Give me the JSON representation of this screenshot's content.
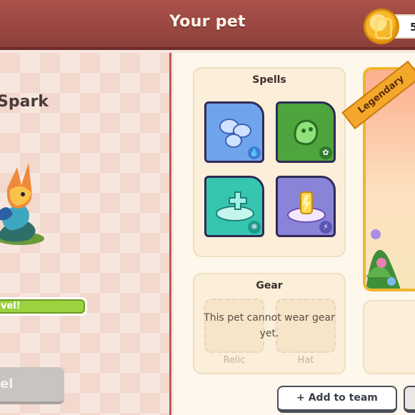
{
  "header": {
    "title": "Your pet"
  },
  "coins": {
    "count": "5",
    "icon": "gold-coin-icon"
  },
  "pet": {
    "name": "Spark",
    "level_text": "vel!",
    "level_button_label": "el"
  },
  "spells": {
    "title": "Spells",
    "items": [
      {
        "name": "water-spell-icon",
        "color": "#6fa3ec",
        "badge_color": "#3f7cd6"
      },
      {
        "name": "earth-spell-icon",
        "color": "#4ea43d",
        "badge_color": "#2f7a2a"
      },
      {
        "name": "ice-spell-icon",
        "color": "#36c6b0",
        "badge_color": "#1e9a8c"
      },
      {
        "name": "storm-spell-icon",
        "color": "#8a84d8",
        "badge_color": "#5c55b5"
      }
    ]
  },
  "gear": {
    "title": "Gear",
    "message": "This pet cannot wear gear yet.",
    "slots": [
      "Relic",
      "Hat"
    ]
  },
  "rarity": {
    "label": "Legendary"
  },
  "actions": {
    "add_to_team": "+ Add to team"
  }
}
